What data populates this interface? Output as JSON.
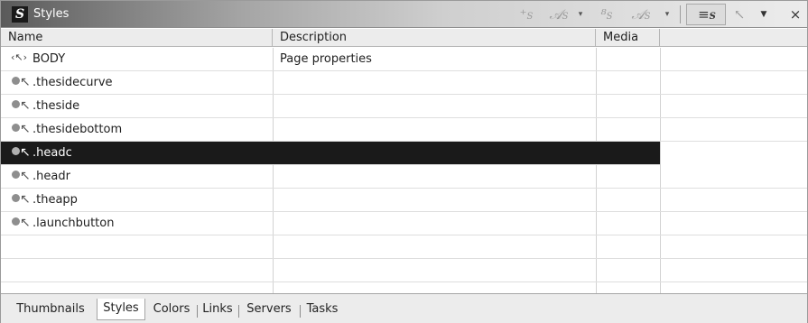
{
  "window": {
    "title": "Styles",
    "app_icon_letter": "S"
  },
  "toolbar": {
    "buttons": [
      {
        "name": "new-style-icon",
        "glyph": "⁺S"
      },
      {
        "name": "edit-style-icon",
        "glyph": "𝒜S"
      },
      {
        "name": "dropdown-arrow",
        "glyph": "▾"
      },
      {
        "name": "duplicate-style-icon",
        "glyph": "₈S"
      },
      {
        "name": "style-sheet-icon",
        "glyph": "𝒜S"
      },
      {
        "name": "dropdown-arrow-2",
        "glyph": "▾"
      },
      {
        "name": "style-list-icon",
        "glyph": "≡S"
      },
      {
        "name": "pointer-icon",
        "glyph": "↖"
      },
      {
        "name": "menu-triangle-icon",
        "glyph": "▼"
      },
      {
        "name": "close-icon",
        "glyph": "×"
      }
    ]
  },
  "table": {
    "columns": [
      "Name",
      "Description",
      "Media",
      ""
    ],
    "rows": [
      {
        "icon": "body-icon",
        "name": "BODY",
        "description": "Page properties",
        "media": "",
        "selected": false
      },
      {
        "icon": "class-style-icon",
        "name": ".thesidecurve",
        "description": "",
        "media": "",
        "selected": false
      },
      {
        "icon": "class-style-icon",
        "name": ".theside",
        "description": "",
        "media": "",
        "selected": false
      },
      {
        "icon": "class-style-icon",
        "name": ".thesidebottom",
        "description": "",
        "media": "",
        "selected": false
      },
      {
        "icon": "class-style-icon",
        "name": ".headc",
        "description": "",
        "media": "",
        "selected": true
      },
      {
        "icon": "class-style-icon",
        "name": ".headr",
        "description": "",
        "media": "",
        "selected": false
      },
      {
        "icon": "class-style-icon",
        "name": ".theapp",
        "description": "",
        "media": "",
        "selected": false
      },
      {
        "icon": "class-style-icon",
        "name": ".launchbutton",
        "description": "",
        "media": "",
        "selected": false
      }
    ]
  },
  "tabs": [
    "Thumbnails",
    "Styles",
    "Colors",
    "Links",
    "Servers",
    "Tasks"
  ],
  "active_tab": "Styles",
  "colors": {
    "selection": "#1a1a1a",
    "header_bg": "#ececec",
    "titlebar_dark": "#5a5a5a"
  }
}
